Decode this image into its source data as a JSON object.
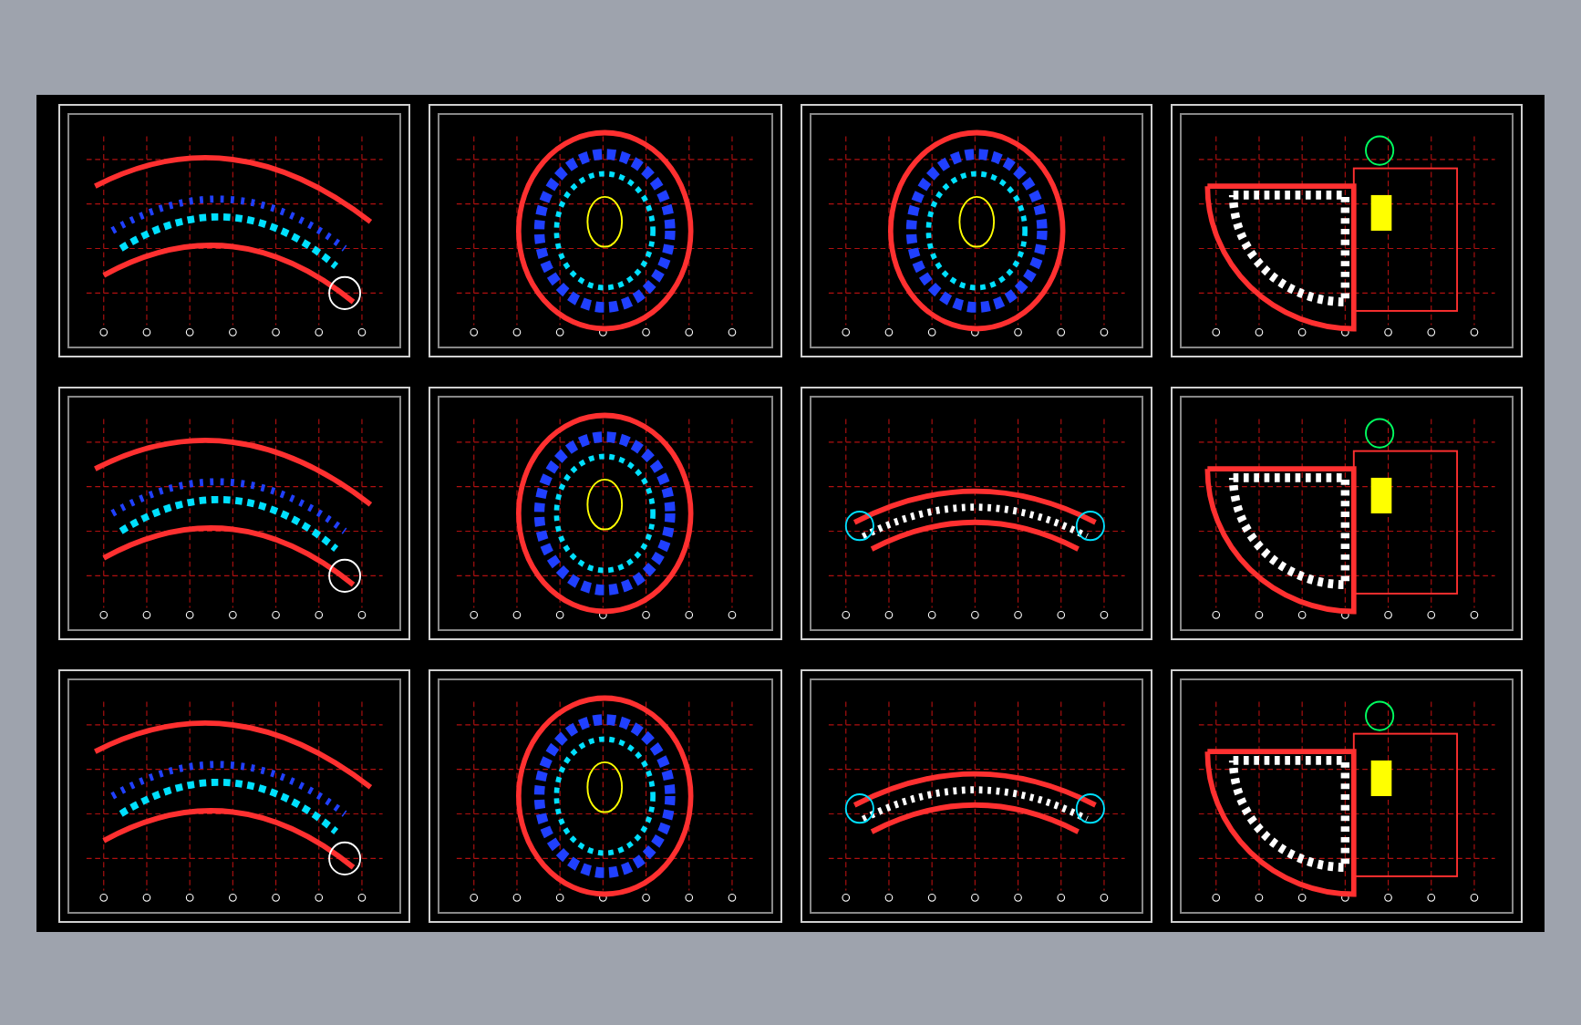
{
  "sheets": [
    {
      "kind": "arc"
    },
    {
      "kind": "oval"
    },
    {
      "kind": "oval"
    },
    {
      "kind": "fan"
    },
    {
      "kind": "arc"
    },
    {
      "kind": "oval"
    },
    {
      "kind": "small-arc"
    },
    {
      "kind": "fan"
    },
    {
      "kind": "arc"
    },
    {
      "kind": "oval"
    },
    {
      "kind": "small-arc"
    },
    {
      "kind": "fan"
    }
  ]
}
